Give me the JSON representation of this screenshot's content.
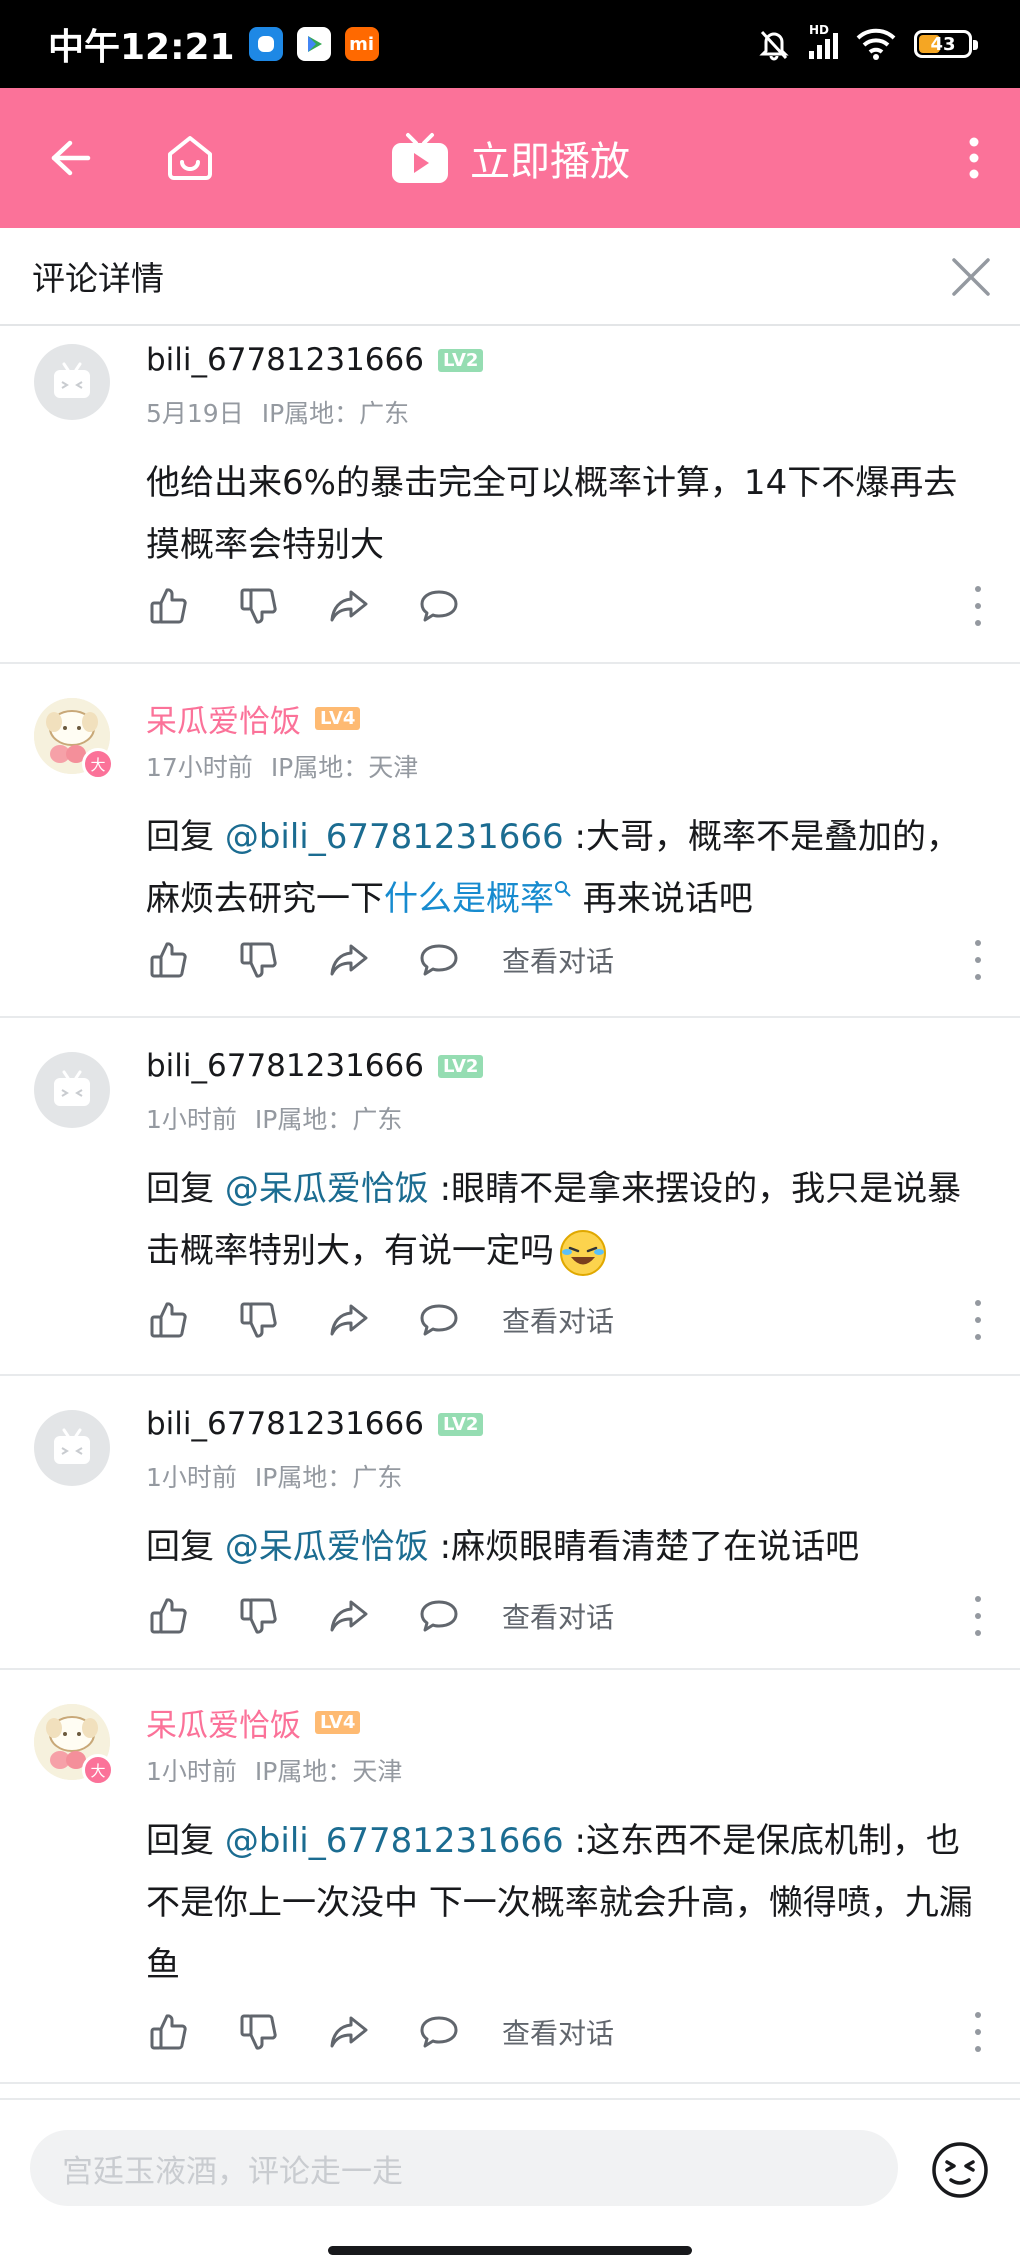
{
  "status_bar": {
    "time": "中午12:21",
    "apps": [
      "app-blue",
      "app-play",
      "mi"
    ],
    "mi_label": "mi",
    "hd_label": "HD",
    "battery": "43"
  },
  "top_bar": {
    "play_now_label": "立即播放",
    "accent_color": "#fb7299"
  },
  "sub_header": {
    "title": "评论详情"
  },
  "comments": [
    {
      "username": "bili_67781231666",
      "level": "LV2",
      "date": "5月19日",
      "ip": "IP属地：广东",
      "text": "他给出来6%的暴击完全可以概率计算，14下不爆再去摸概率会特别大"
    },
    {
      "username": "呆瓜爱恰饭",
      "level": "LV4",
      "date": "17小时前",
      "ip": "IP属地：天津",
      "reply_prefix": "回复 ",
      "mention": "@bili_67781231666",
      "text_a": " :大哥，概率不是叠加的，麻烦去研究一下",
      "link": "什么是概率",
      "text_b": " 再来说话吧",
      "view_convo": "查看对话"
    },
    {
      "username": "bili_67781231666",
      "level": "LV2",
      "date": "1小时前",
      "ip": "IP属地：广东",
      "reply_prefix": "回复 ",
      "mention": "@呆瓜爱恰饭",
      "text": " :眼睛不是拿来摆设的，我只是说暴击概率特别大，有说一定吗",
      "view_convo": "查看对话"
    },
    {
      "username": "bili_67781231666",
      "level": "LV2",
      "date": "1小时前",
      "ip": "IP属地：广东",
      "reply_prefix": "回复 ",
      "mention": "@呆瓜爱恰饭",
      "text": " :麻烦眼睛看清楚了在说话吧",
      "view_convo": "查看对话"
    },
    {
      "username": "呆瓜爱恰饭",
      "level": "LV4",
      "date": "1小时前",
      "ip": "IP属地：天津",
      "reply_prefix": "回复 ",
      "mention": "@bili_67781231666",
      "text": " :这东西不是保底机制，也不是你上一次没中 下一次概率就会升高，懒得喷，九漏鱼",
      "view_convo": "查看对话"
    }
  ],
  "vip_badge": "大",
  "input": {
    "placeholder": "宫廷玉液酒，评论走一走"
  }
}
